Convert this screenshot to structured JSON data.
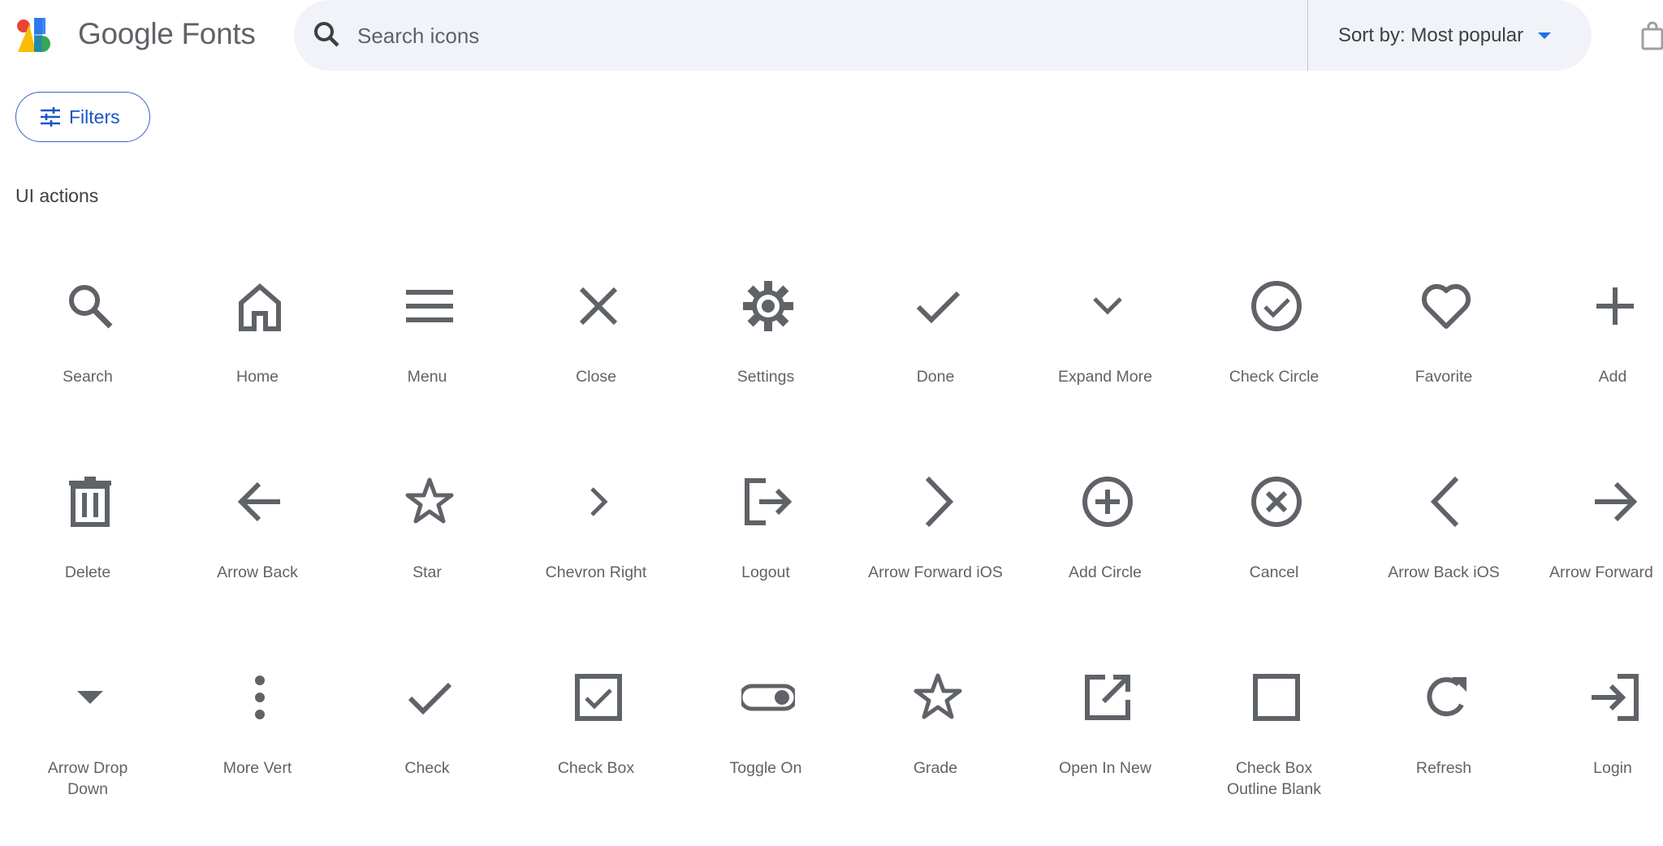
{
  "brand": {
    "name": "Google Fonts"
  },
  "search": {
    "placeholder": "Search icons",
    "value": ""
  },
  "sort": {
    "label": "Sort by: Most popular"
  },
  "filters": {
    "label": "Filters"
  },
  "section": {
    "title": "UI actions"
  },
  "icons": [
    {
      "name": "search-icon",
      "label": "Search"
    },
    {
      "name": "home-icon",
      "label": "Home"
    },
    {
      "name": "menu-icon",
      "label": "Menu"
    },
    {
      "name": "close-icon",
      "label": "Close"
    },
    {
      "name": "settings-icon",
      "label": "Settings"
    },
    {
      "name": "done-icon",
      "label": "Done"
    },
    {
      "name": "expand-more-icon",
      "label": "Expand More"
    },
    {
      "name": "check-circle-icon",
      "label": "Check Circle"
    },
    {
      "name": "favorite-icon",
      "label": "Favorite"
    },
    {
      "name": "add-icon",
      "label": "Add"
    },
    {
      "name": "delete-icon",
      "label": "Delete"
    },
    {
      "name": "arrow-back-icon",
      "label": "Arrow Back"
    },
    {
      "name": "star-icon",
      "label": "Star"
    },
    {
      "name": "chevron-right-icon",
      "label": "Chevron Right"
    },
    {
      "name": "logout-icon",
      "label": "Logout"
    },
    {
      "name": "arrow-forward-ios-icon",
      "label": "Arrow Forward iOS"
    },
    {
      "name": "add-circle-icon",
      "label": "Add Circle"
    },
    {
      "name": "cancel-icon",
      "label": "Cancel"
    },
    {
      "name": "arrow-back-ios-icon",
      "label": "Arrow Back iOS"
    },
    {
      "name": "arrow-forward-icon",
      "label": "Arrow Forward"
    },
    {
      "name": "arrow-drop-down-icon",
      "label": "Arrow Drop Down"
    },
    {
      "name": "more-vert-icon",
      "label": "More Vert"
    },
    {
      "name": "check-icon",
      "label": "Check"
    },
    {
      "name": "check-box-icon",
      "label": "Check Box"
    },
    {
      "name": "toggle-on-icon",
      "label": "Toggle On"
    },
    {
      "name": "grade-icon",
      "label": "Grade"
    },
    {
      "name": "open-in-new-icon",
      "label": "Open In New"
    },
    {
      "name": "check-box-outline-blank-icon",
      "label": "Check Box Outline Blank"
    },
    {
      "name": "refresh-icon",
      "label": "Refresh"
    },
    {
      "name": "login-icon",
      "label": "Login"
    }
  ],
  "colors": {
    "icon": "#5f6368",
    "accent": "#1a73e8",
    "search_bg": "#f1f3f8"
  }
}
